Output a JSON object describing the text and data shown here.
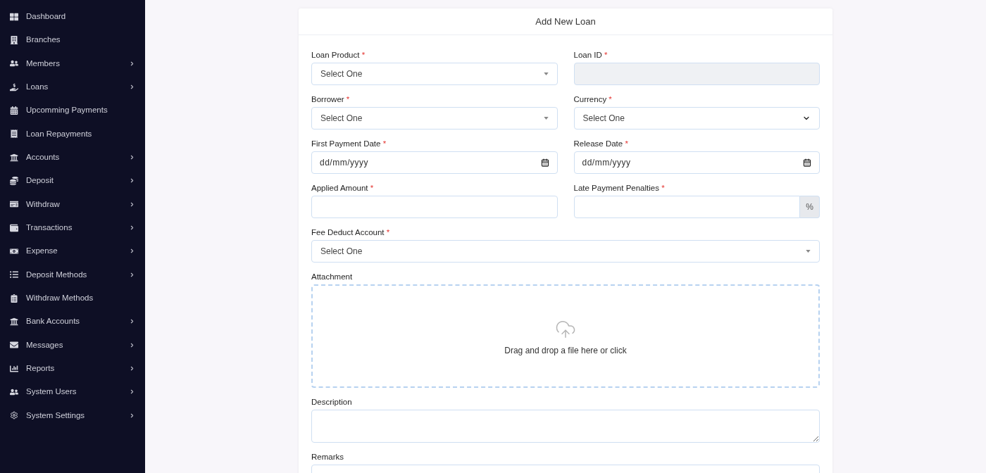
{
  "sidebar": {
    "items": [
      {
        "label": "Dashboard",
        "submenu": false
      },
      {
        "label": "Branches",
        "submenu": false
      },
      {
        "label": "Members",
        "submenu": true
      },
      {
        "label": "Loans",
        "submenu": true
      },
      {
        "label": "Upcomming Payments",
        "submenu": false
      },
      {
        "label": "Loan Repayments",
        "submenu": false
      },
      {
        "label": "Accounts",
        "submenu": true
      },
      {
        "label": "Deposit",
        "submenu": true
      },
      {
        "label": "Withdraw",
        "submenu": true
      },
      {
        "label": "Transactions",
        "submenu": true
      },
      {
        "label": "Expense",
        "submenu": true
      },
      {
        "label": "Deposit Methods",
        "submenu": true
      },
      {
        "label": "Withdraw Methods",
        "submenu": false
      },
      {
        "label": "Bank Accounts",
        "submenu": true
      },
      {
        "label": "Messages",
        "submenu": true
      },
      {
        "label": "Reports",
        "submenu": true
      },
      {
        "label": "System Users",
        "submenu": true
      },
      {
        "label": "System Settings",
        "submenu": true
      }
    ]
  },
  "form": {
    "title": "Add New Loan",
    "rows": [
      {
        "fields": [
          {
            "kind": "combobox",
            "label": "Loan Product",
            "required_mark": "*",
            "value": "Select One",
            "readonly": false
          },
          {
            "kind": "input",
            "label": "Loan ID",
            "required_mark": "*",
            "readonly": true
          }
        ]
      },
      {
        "fields": [
          {
            "kind": "combobox",
            "label": "Borrower",
            "required_mark": "*",
            "value": "Select One",
            "readonly": false
          },
          {
            "kind": "select",
            "label": "Currency",
            "required_mark": "*",
            "value": "Select One",
            "readonly": false
          }
        ]
      },
      {
        "fields": [
          {
            "kind": "date",
            "label": "First Payment Date",
            "required_mark": "*",
            "placeholder": "dd/mm/yyyy",
            "readonly": false
          },
          {
            "kind": "date",
            "label": "Release Date",
            "required_mark": "*",
            "placeholder": "dd/mm/yyyy",
            "readonly": false
          }
        ]
      },
      {
        "fields": [
          {
            "kind": "input",
            "label": "Applied Amount",
            "required_mark": "*",
            "readonly": false
          },
          {
            "kind": "addon",
            "label": "Late Payment Penalties",
            "required_mark": "*",
            "addon": "%",
            "readonly": false
          }
        ]
      },
      {
        "fields": [
          {
            "kind": "combobox",
            "label": "Fee Deduct Account",
            "required_mark": "*",
            "value": "Select One",
            "readonly": false
          }
        ]
      },
      {
        "fields": [
          {
            "kind": "dropzone",
            "label": "Attachment",
            "message": "Drag and drop a file here or click",
            "readonly": false
          }
        ]
      },
      {
        "fields": [
          {
            "kind": "textarea",
            "label": "Description",
            "readonly": false
          }
        ]
      },
      {
        "fields": [
          {
            "kind": "textarea",
            "label": "Remarks",
            "readonly": false
          }
        ]
      }
    ]
  }
}
